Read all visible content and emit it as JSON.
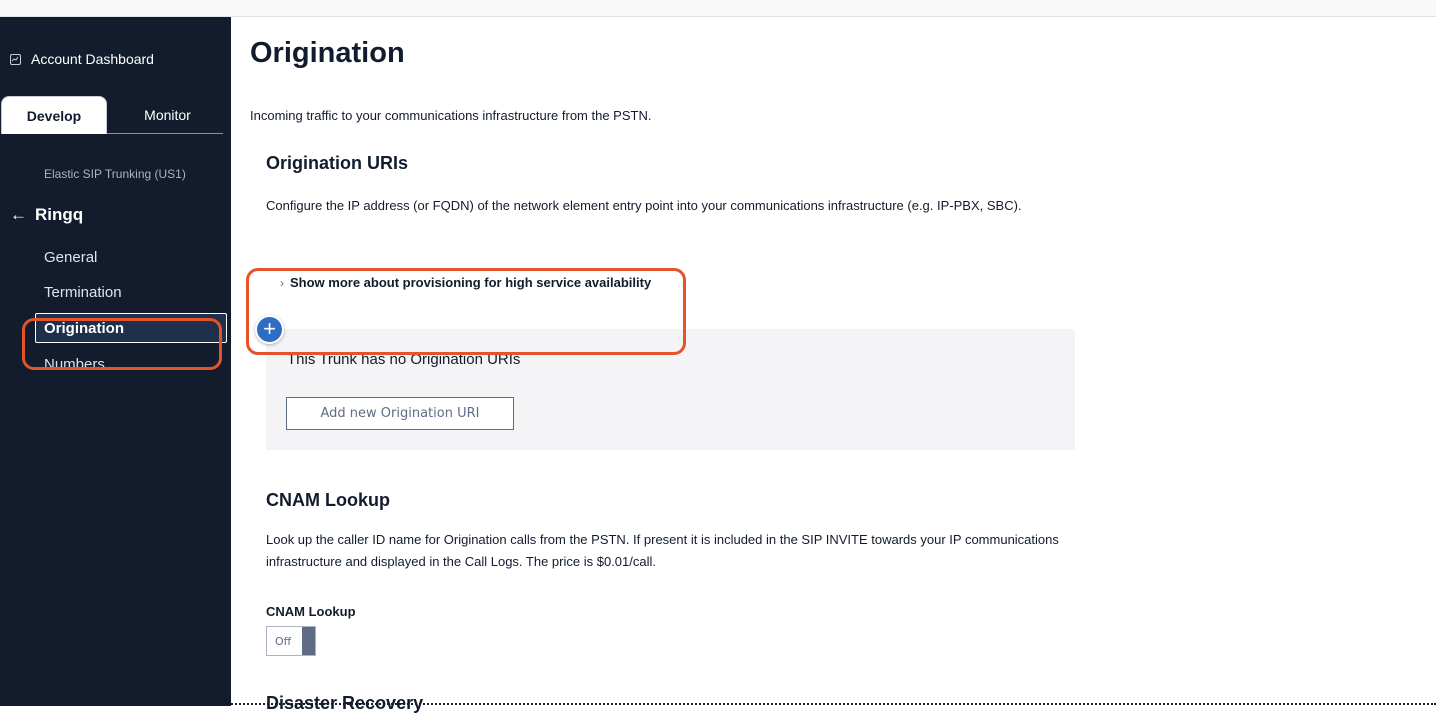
{
  "sidebar": {
    "dashboard_label": "Account Dashboard",
    "tabs": [
      {
        "label": "Develop",
        "active": true
      },
      {
        "label": "Monitor",
        "active": false
      }
    ],
    "service_label": "Elastic SIP Trunking (US1)",
    "back_label": "Ringq",
    "back_arrow": "←",
    "items": [
      {
        "label": "General"
      },
      {
        "label": "Termination"
      },
      {
        "label": "Origination",
        "active": true
      },
      {
        "label": "Numbers"
      }
    ]
  },
  "main": {
    "title": "Origination",
    "description": "Incoming traffic to your communications infrastructure from the PSTN.",
    "uris": {
      "heading": "Origination URIs",
      "description": "Configure the IP address (or FQDN) of the network element entry point into your communications infrastructure (e.g. IP-PBX, SBC).",
      "show_more_chevron": "›",
      "show_more": "Show more about provisioning for high service availability",
      "empty_text": "This Trunk has no Origination URIs",
      "add_button": "Add new Origination URI",
      "plus_symbol": "+"
    },
    "cnam": {
      "heading": "CNAM Lookup",
      "description": "Look up the caller ID name for Origination calls from the PSTN. If present it is included in the SIP INVITE towards your IP communications infrastructure and displayed in the Call Logs. The price is $0.01/call.",
      "toggle_label": "CNAM Lookup",
      "toggle_state": "Off"
    },
    "next_section_heading": "Disaster Recovery"
  },
  "colors": {
    "sidebar_bg": "#121c2d",
    "highlight": "#e3542b",
    "accent_blue": "#2f6cc4"
  }
}
